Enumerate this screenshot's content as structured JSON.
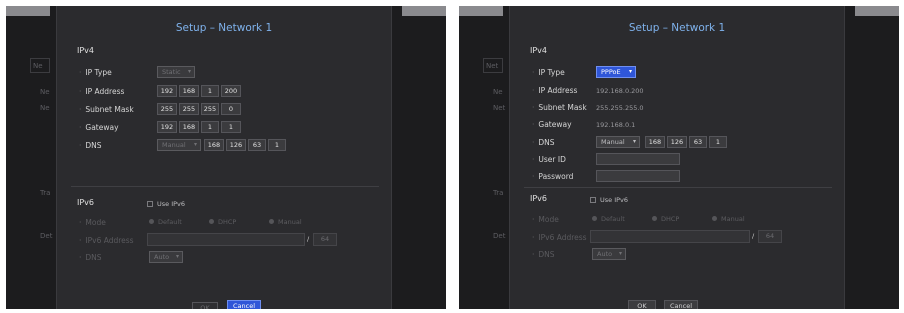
{
  "colors": {
    "accent": "#2f56d8",
    "title": "#7fb2ec",
    "dialog_bg": "#2b2b2e",
    "screen_bg": "#1c1c1e"
  },
  "icons": {
    "dropdown": "chevron-down-icon",
    "bullet": "dot-icon"
  },
  "left": {
    "background": {
      "side_labels": [
        "Ne",
        "Ne",
        "Ne",
        "Tra",
        "Det"
      ]
    },
    "dialog": {
      "title": "Setup – Network 1",
      "ipv4": {
        "heading": "IPv4",
        "ip_type": {
          "label": "IP Type",
          "value": "Static"
        },
        "ip_address": {
          "label": "IP Address",
          "octets": [
            "192",
            "168",
            "1",
            "200"
          ]
        },
        "subnet_mask": {
          "label": "Subnet Mask",
          "octets": [
            "255",
            "255",
            "255",
            "0"
          ]
        },
        "gateway": {
          "label": "Gateway",
          "octets": [
            "192",
            "168",
            "1",
            "1"
          ]
        },
        "dns": {
          "label": "DNS",
          "mode": "Manual",
          "octets": [
            "168",
            "126",
            "63",
            "1"
          ]
        }
      },
      "ipv6": {
        "heading": "IPv6",
        "use_label": "Use IPv6",
        "mode": {
          "label": "Mode",
          "options": [
            "Default",
            "DHCP",
            "Manual"
          ]
        },
        "address": {
          "label": "IPv6 Address",
          "separator": "/",
          "prefix": "64"
        },
        "dns": {
          "label": "DNS",
          "value": "Auto"
        }
      },
      "buttons": {
        "ok": "OK",
        "cancel": "Cancel"
      }
    }
  },
  "right": {
    "background": {
      "side_labels": [
        "Net",
        "Ne",
        "Net",
        "Tra",
        "Det"
      ]
    },
    "dialog": {
      "title": "Setup – Network 1",
      "ipv4": {
        "heading": "IPv4",
        "ip_type": {
          "label": "IP Type",
          "value": "PPPoE"
        },
        "ip_address": {
          "label": "IP Address",
          "value": "192.168.0.200"
        },
        "subnet_mask": {
          "label": "Subnet Mask",
          "value": "255.255.255.0"
        },
        "gateway": {
          "label": "Gateway",
          "value": "192.168.0.1"
        },
        "dns": {
          "label": "DNS",
          "mode": "Manual",
          "octets": [
            "168",
            "126",
            "63",
            "1"
          ]
        },
        "user_id": {
          "label": "User ID",
          "value": ""
        },
        "password": {
          "label": "Password",
          "value": ""
        }
      },
      "ipv6": {
        "heading": "IPv6",
        "use_label": "Use IPv6",
        "mode": {
          "label": "Mode",
          "options": [
            "Default",
            "DHCP",
            "Manual"
          ]
        },
        "address": {
          "label": "IPv6 Address",
          "separator": "/",
          "prefix": "64"
        },
        "dns": {
          "label": "DNS",
          "value": "Auto"
        }
      },
      "buttons": {
        "ok": "OK",
        "cancel": "Cancel"
      }
    }
  }
}
